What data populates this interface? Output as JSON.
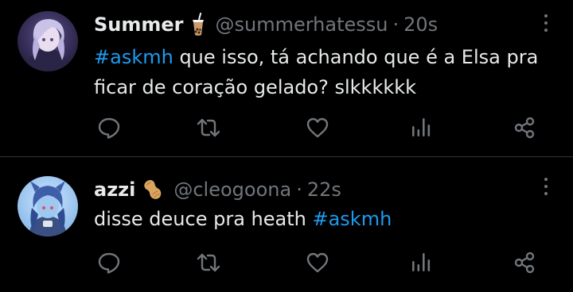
{
  "tweets": [
    {
      "display_name": "Summer",
      "name_emoji": "bubble-tea-icon",
      "handle": "@summerhatessu",
      "separator": "·",
      "time": "20s",
      "hashtag": "#askmh",
      "text": " que isso, tá achando que é a Elsa pra ficar de coração gelado? slkkkkkk"
    },
    {
      "display_name": "azzi",
      "name_emoji": "peanut-icon",
      "handle": "@cleogoona",
      "separator": "·",
      "time": "22s",
      "text": "disse deuce pra heath ",
      "hashtag": "#askmh"
    }
  ],
  "colors": {
    "background": "#000000",
    "text": "#e7e9ea",
    "muted": "#71767b",
    "link": "#1d9bf0",
    "divider": "#2f3336"
  }
}
